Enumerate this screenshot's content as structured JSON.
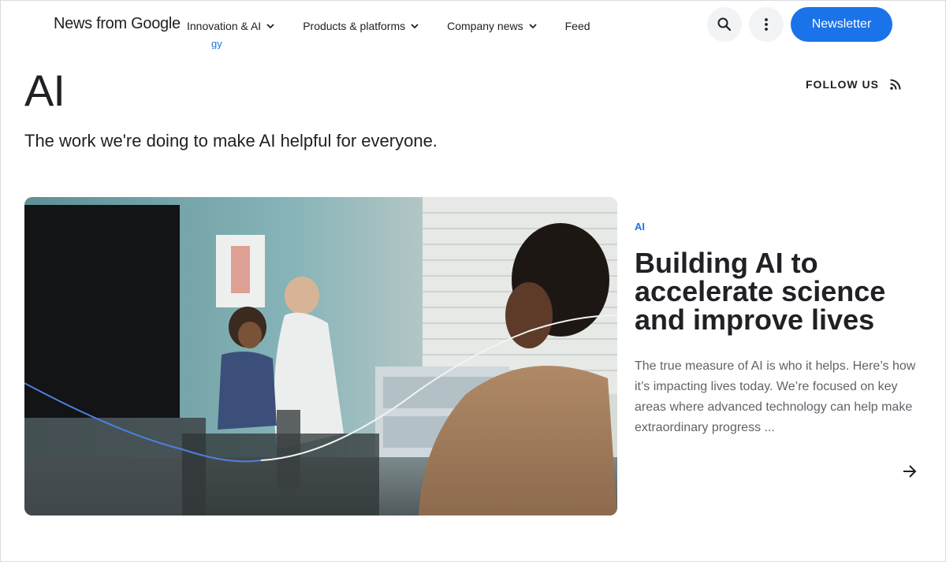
{
  "header": {
    "logo": "News from Google",
    "nav": [
      {
        "label": "Innovation & AI"
      },
      {
        "label": "Products & platforms"
      },
      {
        "label": "Company news"
      },
      {
        "label": "Feed"
      }
    ],
    "newsletter_label": "Newsletter",
    "icons": {
      "search": "search-icon",
      "more": "more-vertical-icon",
      "chevron": "chevron-down-icon"
    }
  },
  "breadcrumb_peek": "gy",
  "hero": {
    "title": "AI",
    "subtitle": "The work we're doing to make AI helpful for everyone.",
    "follow_label": "FOLLOW US",
    "follow_icon": "rss-icon"
  },
  "featured": {
    "tag": "AI",
    "headline": "Building AI to accelerate science and improve lives",
    "summary": "The true measure of AI is who it helps. Here’s how it’s impacting lives today. We’re focused on key areas where advanced technology can help make extraordinary progress ...",
    "arrow_icon": "arrow-right-icon"
  },
  "colors": {
    "accent": "#1a73e8",
    "text": "#202124",
    "muted": "#5f6368"
  }
}
